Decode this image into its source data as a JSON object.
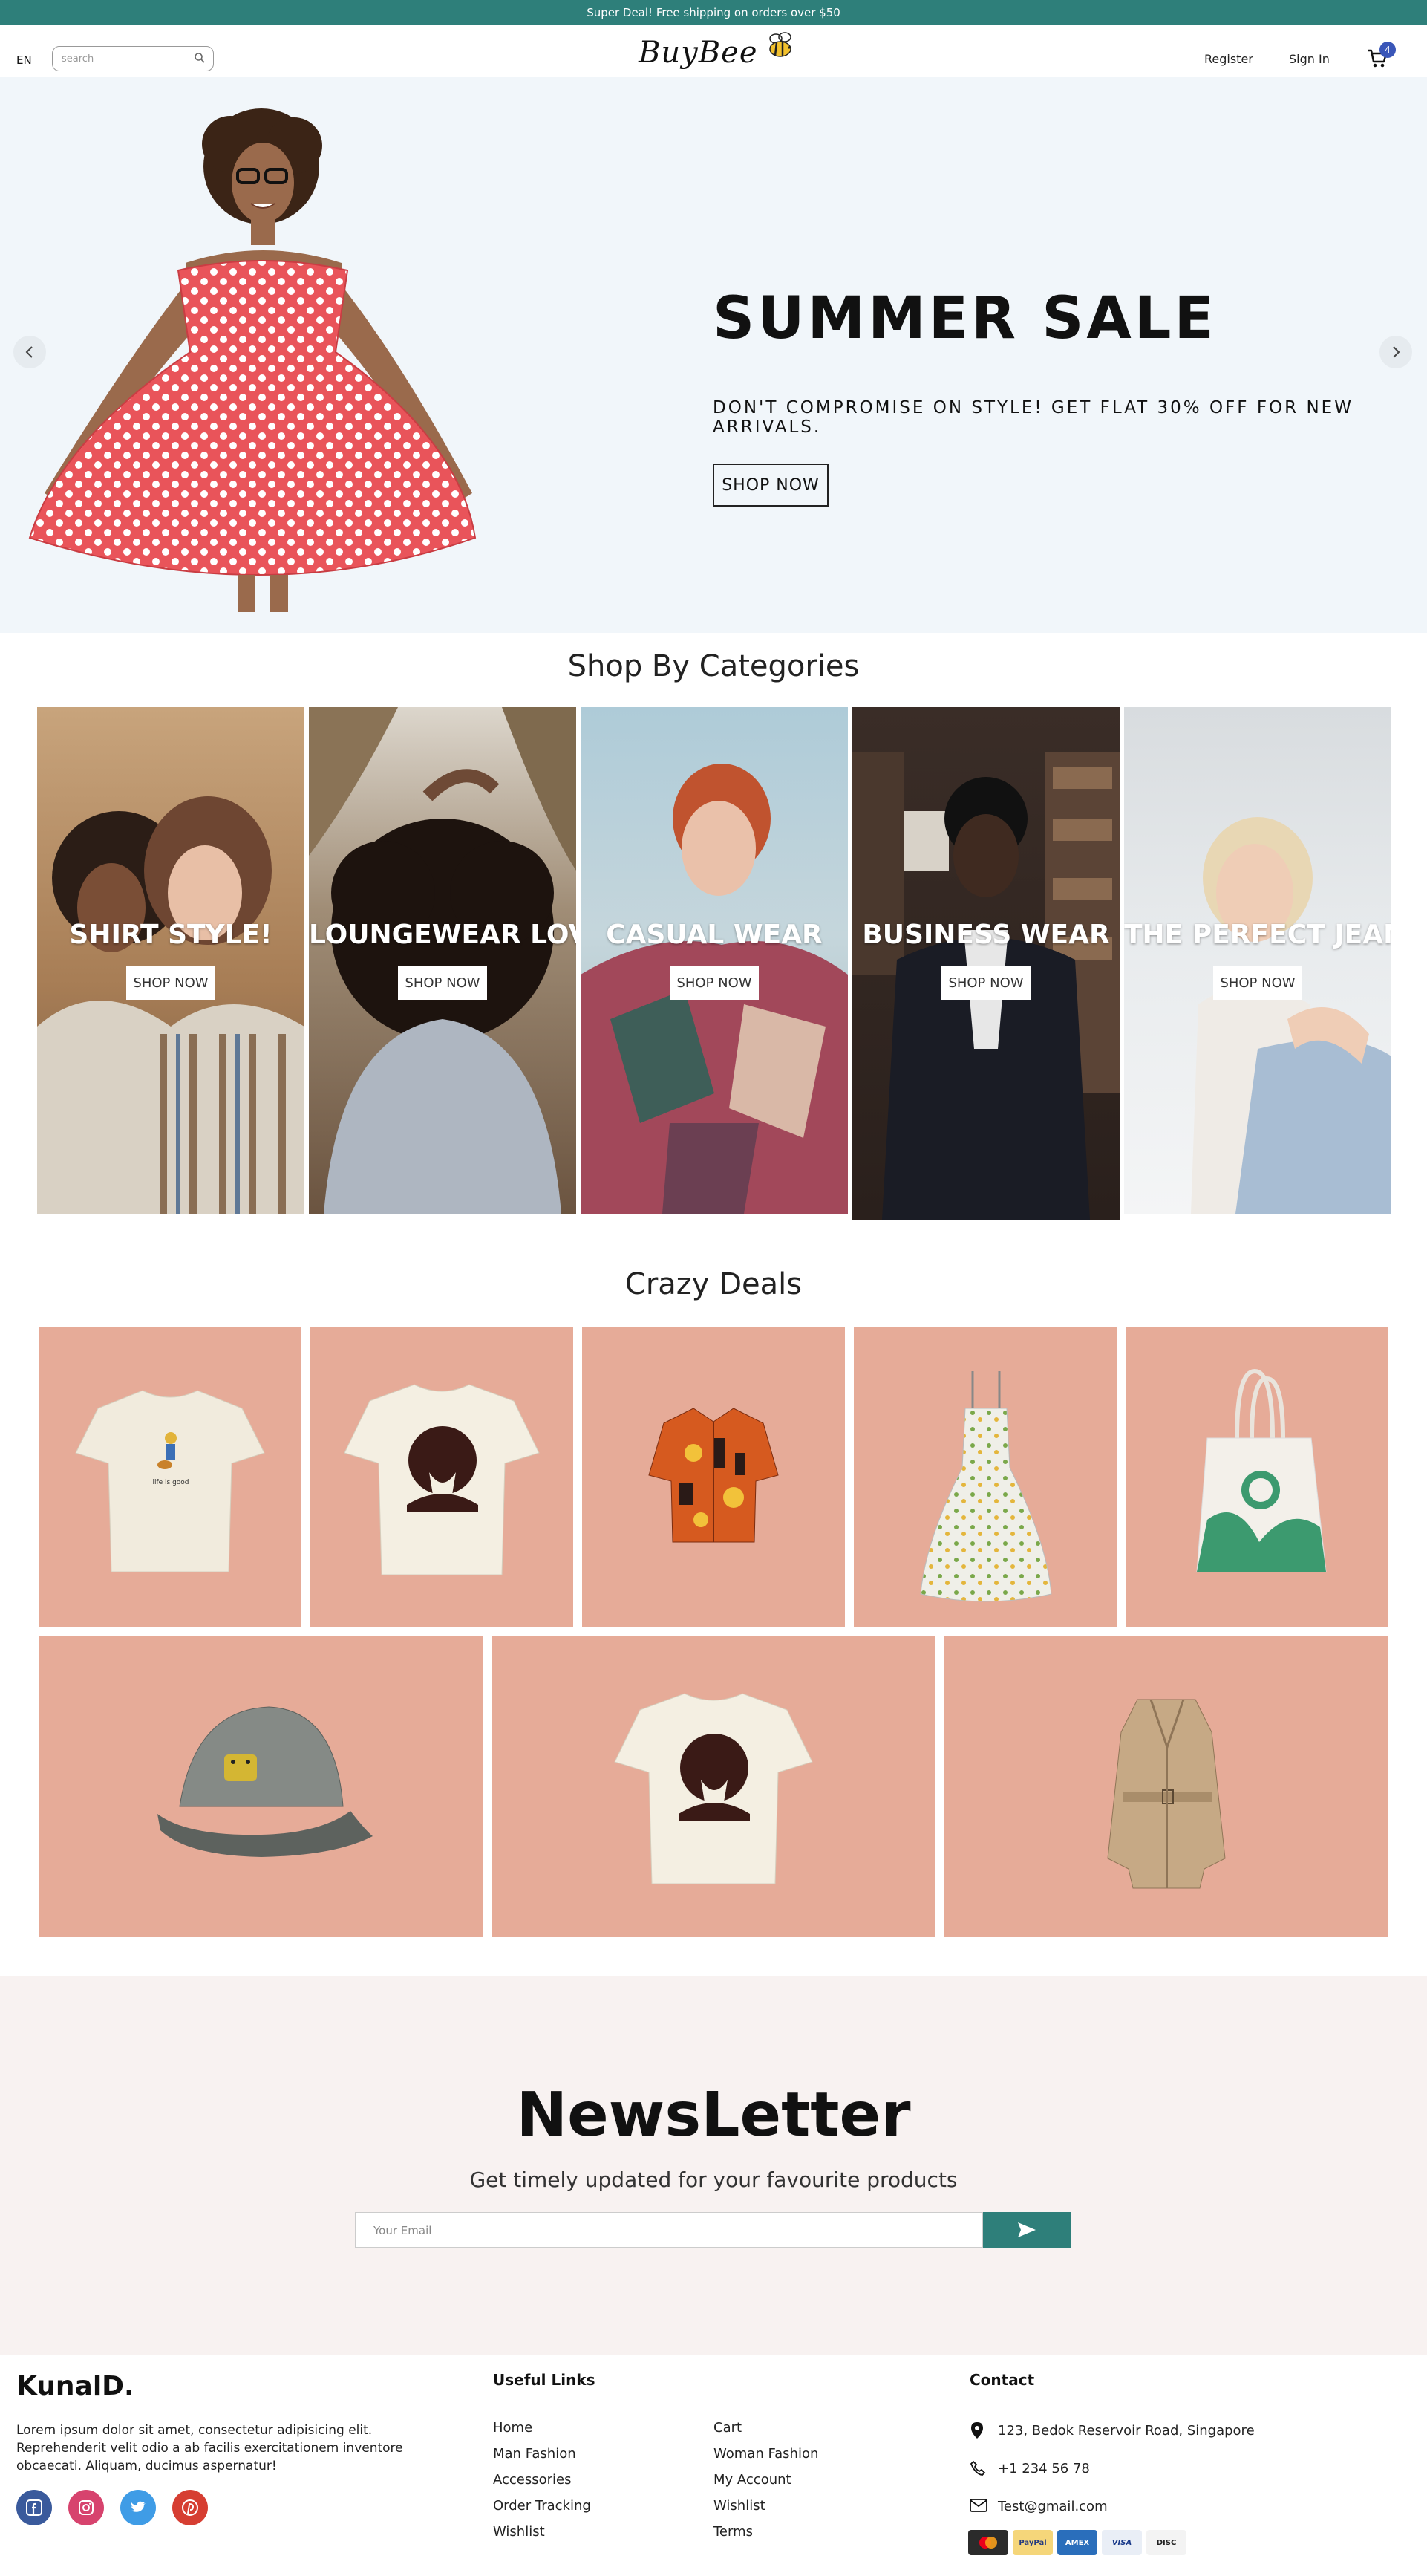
{
  "announcement": "Super Deal! Free shipping on orders over $50",
  "nav": {
    "lang": "EN",
    "search_placeholder": "search",
    "logo": "BuyBee",
    "register": "Register",
    "sign_in": "Sign In",
    "cart_count": "4"
  },
  "hero": {
    "title": "SUMMER SALE",
    "subtitle": "DON'T COMPROMISE ON STYLE! GET FLAT 30% OFF FOR NEW ARRIVALS.",
    "button": "SHOP NOW"
  },
  "categories": {
    "heading": "Shop By Categories",
    "items": [
      {
        "title": "SHIRT STYLE!",
        "button": "SHOP NOW"
      },
      {
        "title": "LOUNGEWEAR LOVE",
        "button": "SHOP NOW"
      },
      {
        "title": "CASUAL WEAR",
        "button": "SHOP NOW"
      },
      {
        "title": "BUSINESS WEAR",
        "button": "SHOP NOW"
      },
      {
        "title": "THE PERFECT JEANS",
        "button": "SHOP NOW"
      }
    ]
  },
  "deals": {
    "heading": "Crazy Deals",
    "items": [
      "guitar-print-tshirt",
      "portrait-print-tshirt",
      "printed-resort-shirt",
      "floral-sundress",
      "printed-tote-bag",
      "cat-patch-cap",
      "portrait-print-tshirt",
      "trench-coat"
    ]
  },
  "newsletter": {
    "title": "NewsLetter",
    "subtitle": "Get timely updated for your favourite products",
    "placeholder": "Your Email"
  },
  "footer": {
    "brand": "KunalD.",
    "description": "Lorem ipsum dolor sit amet, consectetur adipisicing elit. Reprehenderit velit odio a ab facilis exercitationem inventore obcaecati. Aliquam, ducimus aspernatur!",
    "useful_links_heading": "Useful Links",
    "links_left": [
      "Home",
      "Man Fashion",
      "Accessories",
      "Order Tracking",
      "Wishlist"
    ],
    "links_right": [
      "Cart",
      "Woman Fashion",
      "My Account",
      "Wishlist",
      "Terms"
    ],
    "contact_heading": "Contact",
    "address": "123, Bedok Reservoir Road, Singapore",
    "phone": "+1 234 56 78",
    "email": "Test@gmail.com",
    "payments": [
      "MasterCard",
      "PayPal",
      "American Express",
      "VISA",
      "DISCOVER"
    ]
  },
  "colors": {
    "accent": "#2e7f7a",
    "deal_bg": "#e6ab98",
    "hero_bg": "#f1f6fa",
    "newsletter_bg": "#f8f2f1"
  }
}
